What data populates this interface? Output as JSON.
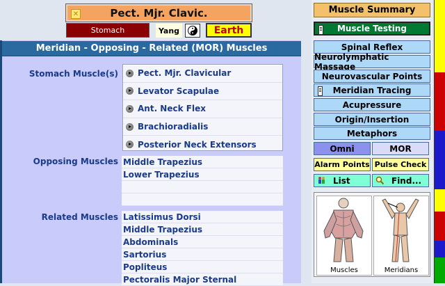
{
  "header": {
    "muscle_title": "Pect. Mjr. Clavic.",
    "meridian": "Stomach",
    "polarity": "Yang",
    "element": "Earth",
    "colors": {
      "title_bg": "#f4a460",
      "meridian_bg": "#8b0000",
      "element_bg": "#ffff00",
      "element_text": "#c00000"
    }
  },
  "panel": {
    "title": "Meridian - Opposing - Related (MOR) Muscles",
    "stomach_label": "Stomach Muscle(s)",
    "stomach_muscles": [
      "Pect. Mjr. Clavicular",
      "Levator Scapulae",
      "Ant. Neck Flex",
      "Brachioradialis",
      "Posterior Neck Extensors"
    ],
    "opposing_label": "Opposing Muscles",
    "opposing_muscles": [
      "Middle Trapezius",
      "Lower Trapezius",
      "",
      ""
    ],
    "related_label": "Related Muscles",
    "related_muscles": [
      "Latissimus Dorsi",
      "Middle Trapezius",
      "Abdominals",
      "Sartorius",
      "Popliteus",
      "Pectoralis Major Sternal"
    ]
  },
  "nav": {
    "muscle_summary": "Muscle Summary",
    "muscle_testing": "Muscle Testing",
    "spinal_reflex": "Spinal Reflex",
    "neurolymphatic": "Neurolymphatic Massage",
    "neurovascular": "Neurovascular Points",
    "meridian_tracing": "Meridian Tracing",
    "acupressure": "Acupressure",
    "origin_insertion": "Origin/Insertion",
    "metaphors": "Metaphors",
    "omni": "Omni",
    "mor": "MOR",
    "alarm_points": "Alarm Points",
    "pulse_check": "Pulse Check",
    "list": "List",
    "find": "Find..."
  },
  "images": {
    "muscles_caption": "Muscles",
    "meridians_caption": "Meridians"
  },
  "strip_colors": [
    "#ffff00",
    "#ffff00",
    "#cc0000",
    "#cc0000",
    "#1a1acc",
    "#1a1acc",
    "#ffff00",
    "#cc0000",
    "#1a1acc",
    "#00aa00"
  ]
}
